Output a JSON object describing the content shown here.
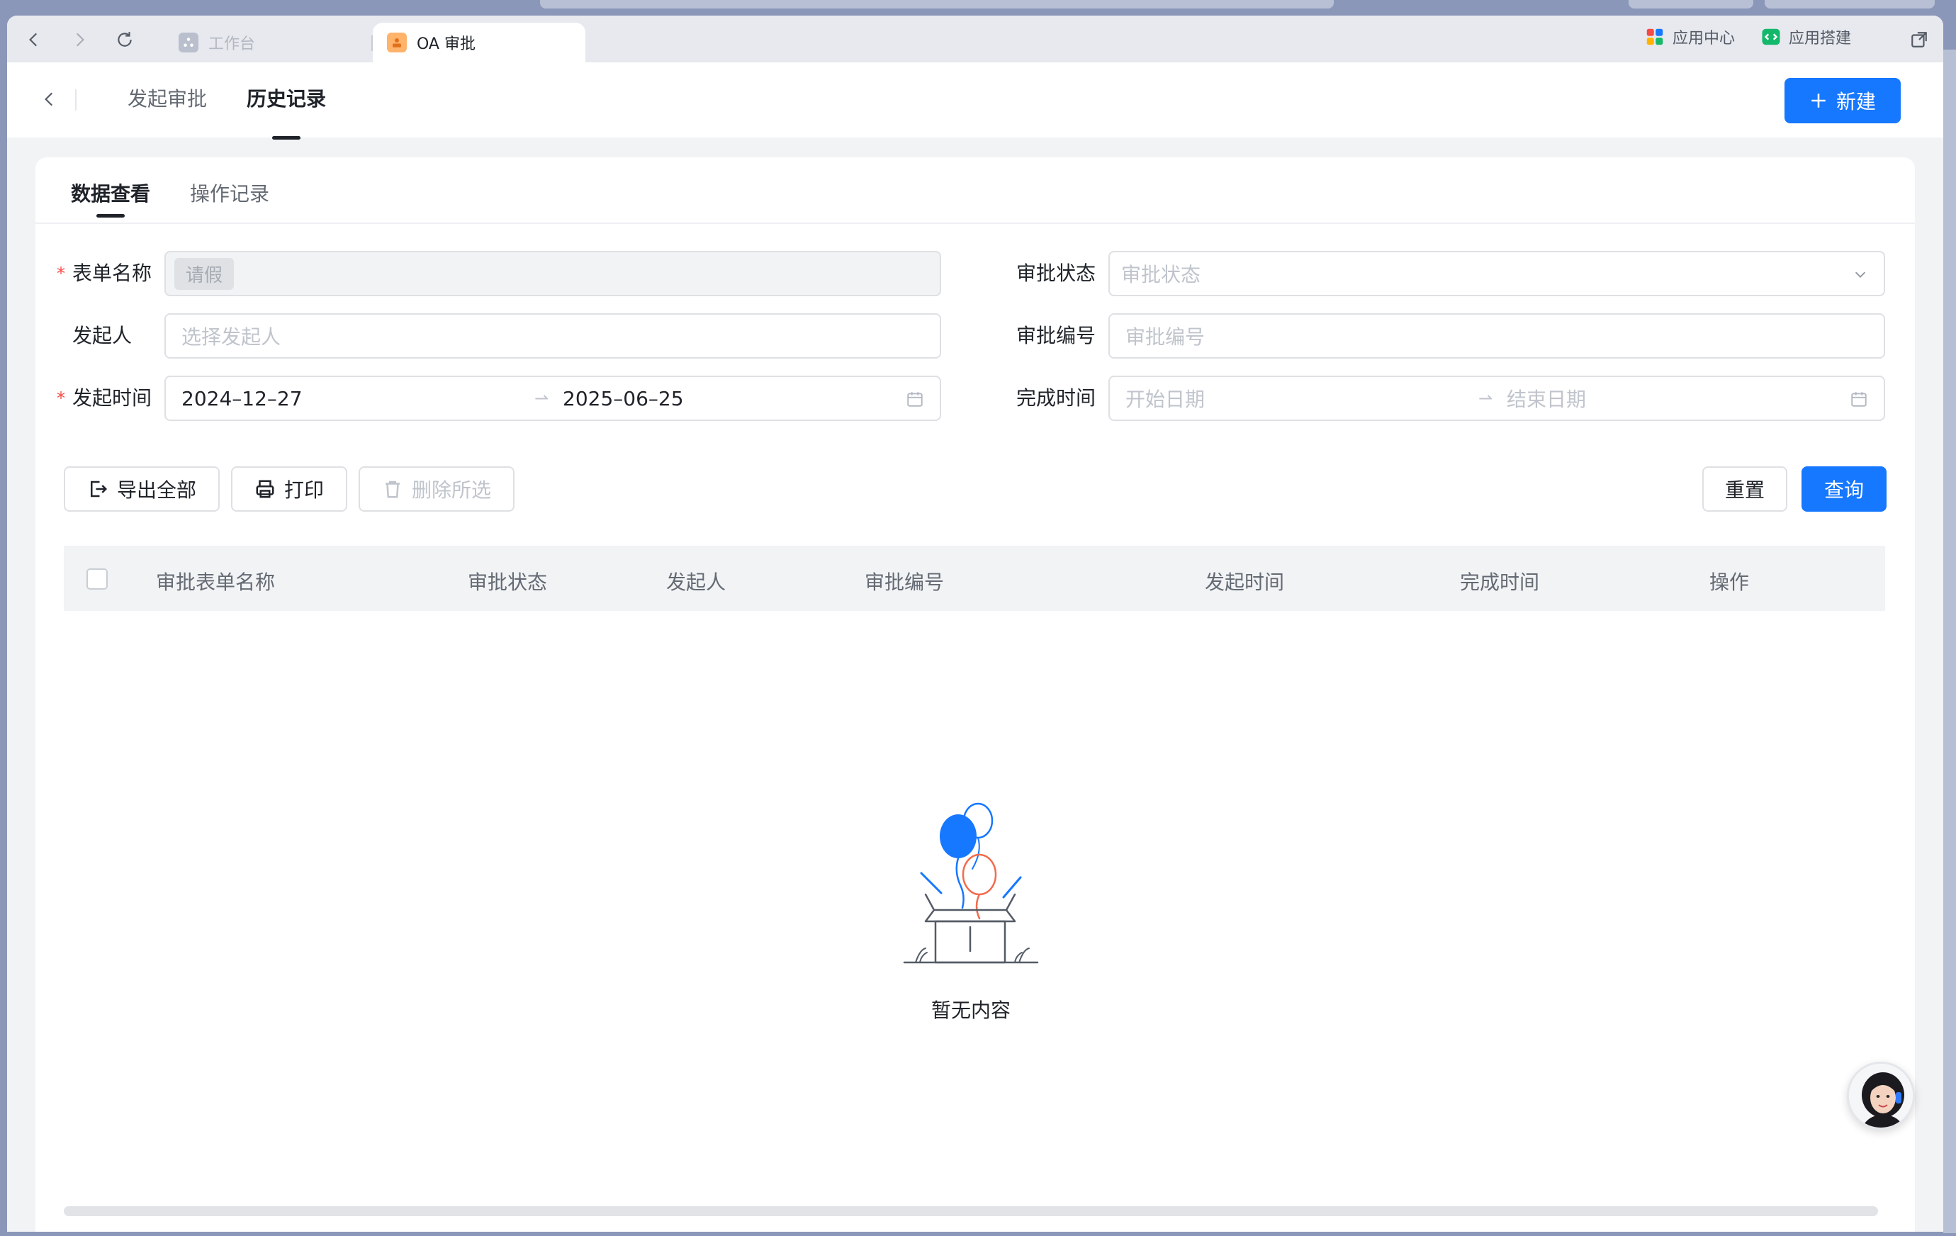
{
  "browser": {
    "tabs": [
      {
        "label": "工作台",
        "active": false
      },
      {
        "label": "OA 审批",
        "active": true
      }
    ],
    "toolbar": {
      "app_center": "应用中心",
      "app_builder": "应用搭建"
    }
  },
  "header": {
    "tabs": [
      "发起审批",
      "历史记录"
    ],
    "active_tab": "历史记录",
    "new_button": "新建"
  },
  "subtabs": [
    "数据查看",
    "操作记录"
  ],
  "filters": {
    "form_name": {
      "label": "表单名称",
      "required": true,
      "tag": "请假"
    },
    "status": {
      "label": "审批状态",
      "placeholder": "审批状态"
    },
    "initiator": {
      "label": "发起人",
      "placeholder": "选择发起人"
    },
    "code": {
      "label": "审批编号",
      "placeholder": "审批编号"
    },
    "start_time": {
      "label": "发起时间",
      "required": true,
      "from": "2024–12–27",
      "to": "2025–06–25"
    },
    "finish_time": {
      "label": "完成时间",
      "from_placeholder": "开始日期",
      "to_placeholder": "结束日期"
    }
  },
  "actions": {
    "export_all": "导出全部",
    "print": "打印",
    "delete_selected": "删除所选",
    "reset": "重置",
    "query": "查询"
  },
  "table": {
    "columns": [
      "审批表单名称",
      "审批状态",
      "发起人",
      "审批编号",
      "发起时间",
      "完成时间",
      "操作"
    ],
    "rows": []
  },
  "empty_text": "暂无内容",
  "colors": {
    "primary": "#1677ff",
    "required": "#f54a45",
    "balloon_blue": "#1677ff",
    "balloon_red": "#f26b4b"
  }
}
